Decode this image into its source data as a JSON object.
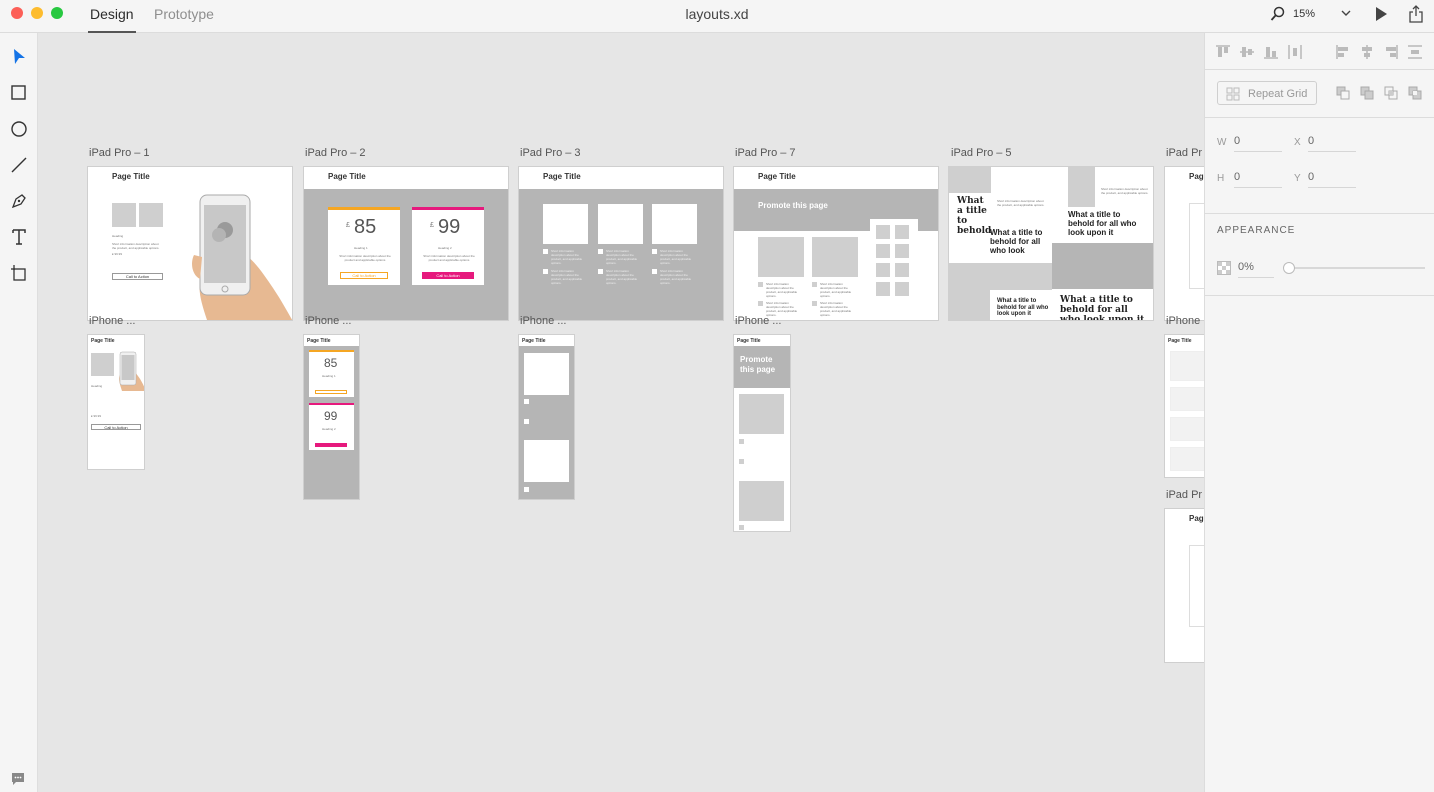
{
  "titlebar": {
    "tabs": {
      "design": "Design",
      "prototype": "Prototype"
    },
    "document_title": "layouts.xd",
    "zoom": "15%"
  },
  "toolbar": {
    "tools": [
      "select-icon",
      "rectangle-icon",
      "ellipse-icon",
      "line-icon",
      "pen-icon",
      "text-icon",
      "artboard-icon"
    ]
  },
  "artboards": {
    "ipad1": {
      "label": "iPad Pro – 1",
      "title": "Page Title",
      "heading": "Heading",
      "body": "Short information description about the product, and applicable options.",
      "price": "£ 99.99",
      "cta": "Call to Action"
    },
    "ipad2": {
      "label": "iPad Pro – 2",
      "title": "Page Title",
      "price1": "85",
      "price2": "99",
      "currency": "£",
      "heading1": "Heading 1",
      "heading2": "Heading 2",
      "body": "Short information description about the product and applicable options",
      "cta": "Call to Action",
      "accent1": "#f5a623",
      "accent2": "#e6197d"
    },
    "ipad3": {
      "label": "iPad Pro – 3",
      "title": "Page Title",
      "body": "Short information description about the product, and applicable options."
    },
    "ipad7": {
      "label": "iPad Pro – 7",
      "title": "Page Title",
      "promote": "Promote this page",
      "body": "Short information description about the product, and applicable options."
    },
    "ipad5": {
      "label": "iPad Pro – 5",
      "headline1": "What a title to behold",
      "headline2": "What a title to behold for all who look",
      "headline3": "What a title to behold for all who look upon it",
      "headline4": "What a title to behold for all who look upon it",
      "headline5": "What a title to behold for all who look upon it",
      "body": "Short information description about the product, and applicable options."
    },
    "ipad6": {
      "label": "iPad Pr",
      "title": "Pag"
    },
    "iphone1": {
      "label": "iPhone ...",
      "title": "Page Title",
      "heading": "Heading",
      "price": "£ 99.99",
      "cta": "Call to Action"
    },
    "iphone2": {
      "label": "iPhone ...",
      "title": "Page Title",
      "price1": "85",
      "price2": "99",
      "heading1": "Heading 1",
      "heading2": "Heading 2"
    },
    "iphone3": {
      "label": "iPhone ...",
      "title": "Page Title"
    },
    "iphone4": {
      "label": "iPhone ...",
      "title": "Page Title",
      "promote": "Promote this page"
    },
    "iphone5": {
      "label": "iPhone",
      "title": "Page Title",
      "body": "Short information desc"
    },
    "ipad8": {
      "label": "iPad Pr",
      "title": "Pag"
    }
  },
  "inspector": {
    "repeat_grid": "Repeat Grid",
    "fields": {
      "w_label": "W",
      "w_value": "0",
      "x_label": "X",
      "x_value": "0",
      "h_label": "H",
      "h_value": "0",
      "y_label": "Y",
      "y_value": "0"
    },
    "appearance_label": "APPEARANCE",
    "opacity": "0%"
  }
}
